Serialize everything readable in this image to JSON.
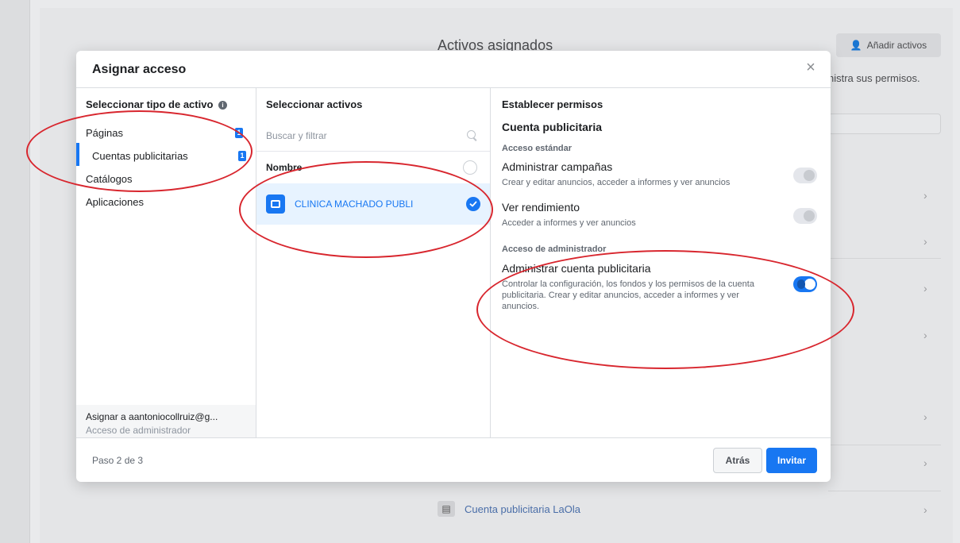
{
  "background": {
    "title": "Activos asignados",
    "add_assets_label": "Añadir activos",
    "subtext": "nistra sus permisos.",
    "bottom_item_label": "Cuenta publicitaria LaOla"
  },
  "modal": {
    "title": "Asignar acceso",
    "close_label": "×",
    "col1": {
      "heading": "Seleccionar tipo de activo",
      "items": [
        {
          "label": "Páginas",
          "count": "1"
        },
        {
          "label": "Cuentas publicitarias",
          "count": "1"
        },
        {
          "label": "Catálogos",
          "count": ""
        },
        {
          "label": "Aplicaciones",
          "count": ""
        }
      ],
      "assign_to": "Asignar a aantoniocollruiz@g...",
      "assign_role": "Acceso de administrador"
    },
    "col2": {
      "heading": "Seleccionar activos",
      "search_placeholder": "Buscar y filtrar",
      "list_heading": "Nombre",
      "asset_name": "CLINICA MACHADO PUBLI"
    },
    "col3": {
      "heading": "Establecer permisos",
      "section_title": "Cuenta publicitaria",
      "standard_title": "Acceso estándar",
      "perm1_name": "Administrar campañas",
      "perm1_desc": "Crear y editar anuncios, acceder a informes y ver anuncios",
      "perm2_name": "Ver rendimiento",
      "perm2_desc": "Acceder a informes y ver anuncios",
      "admin_title": "Acceso de administrador",
      "perm3_name": "Administrar cuenta publicitaria",
      "perm3_desc": "Controlar la configuración, los fondos y los permisos de la cuenta publicitaria. Crear y editar anuncios, acceder a informes y ver anuncios."
    },
    "footer": {
      "step": "Paso 2 de 3",
      "back_label": "Atrás",
      "invite_label": "Invitar"
    }
  },
  "colors": {
    "accent": "#1877f2",
    "annotation": "#d8262e"
  }
}
